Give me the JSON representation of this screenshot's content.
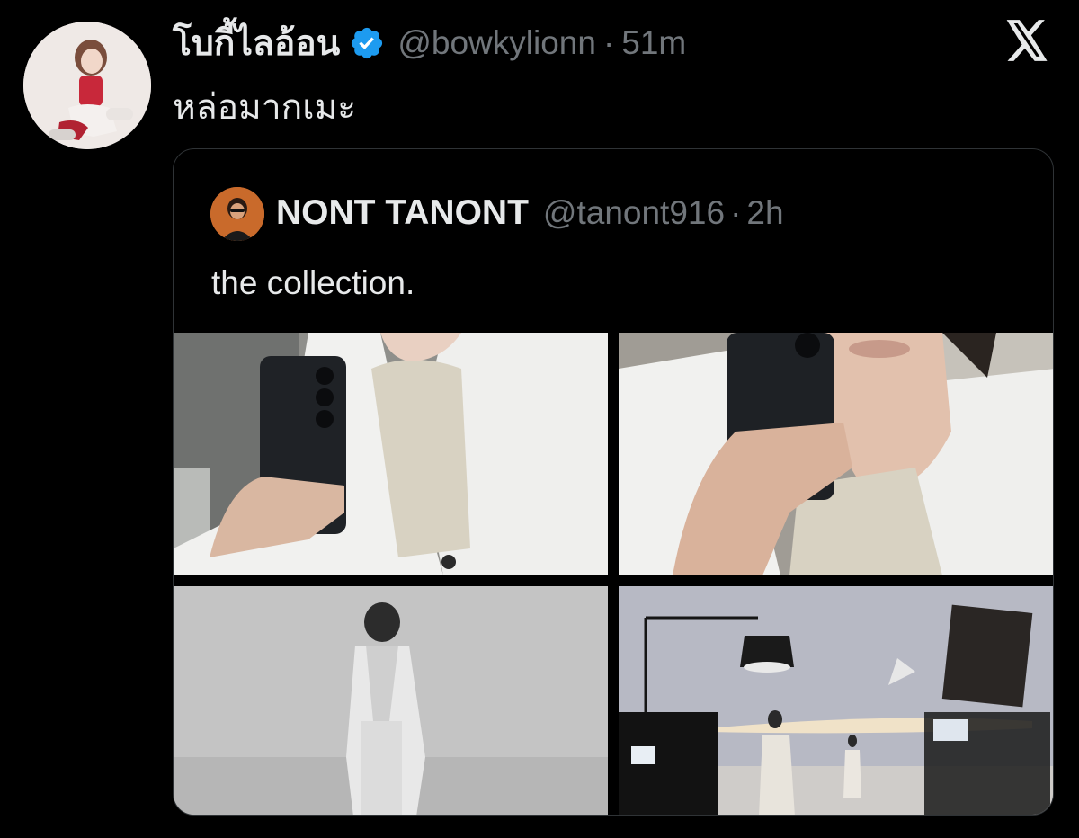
{
  "tweet": {
    "display_name": "โบกี้ไลอ้อน",
    "verified_icon": "verified-badge-icon",
    "handle": "@bowkylionn",
    "separator": "·",
    "time": "51m",
    "text": "หล่อมากเมะ",
    "brand_icon": "x-logo-icon"
  },
  "quoted_tweet": {
    "display_name": "NONT TANONT",
    "handle": "@tanont916",
    "separator": "·",
    "time": "2h",
    "text": "the collection.",
    "media": [
      {
        "icon": "photo-mirror-selfie-1"
      },
      {
        "icon": "photo-mirror-selfie-2"
      },
      {
        "icon": "photo-grayscale-studio-portrait"
      },
      {
        "icon": "photo-studio-behind-the-scenes"
      }
    ]
  },
  "colors": {
    "background": "#000000",
    "primary_text": "#e7e9ea",
    "secondary_text": "#71767b",
    "border": "#2f3336",
    "verified_blue": "#1d9bf0"
  }
}
